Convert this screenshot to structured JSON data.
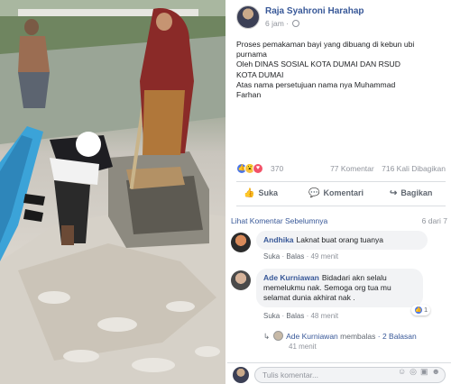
{
  "post": {
    "author": "Raja Syahroni Harahap",
    "time": "6 jam",
    "text": "Proses pemakaman bayi yang dibuang di kebun ubi\npurnama\nOleh DINAS SOSIAL KOTA DUMAI DAN RSUD\nKOTA DUMAI\nAtas nama persetujuan nama nya Muhammad\nFarhan",
    "reaction_count": "370",
    "comment_count": "77 Komentar",
    "share_count": "716 Kali Dibagikan"
  },
  "actions": {
    "like": "Suka",
    "comment": "Komentari",
    "share": "Bagikan"
  },
  "previous_comments": {
    "label": "Lihat Komentar Sebelumnya",
    "time": "6 dari 7"
  },
  "comments": [
    {
      "name": "Andhika",
      "text": "Laknat buat orang tuanya",
      "like": "Suka",
      "reply": "Balas",
      "time": "49 menit"
    },
    {
      "name": "Ade Kurniawan",
      "text": "Bidadari akn selalu memelukmu nak. Semoga org tua mu selamat dunia akhirat nak .",
      "like": "Suka",
      "reply": "Balas",
      "time": "48 menit",
      "likes": "1"
    }
  ],
  "reply": {
    "author": "Ade Kurniawan",
    "label": "membalas",
    "count": "2 Balasan",
    "time": "41 menit"
  },
  "composer": {
    "placeholder": "Tulis komentar..."
  },
  "icons": {
    "reactions": [
      "like-icon",
      "wow-icon",
      "love-icon"
    ],
    "composer": [
      "emoji-icon",
      "camera-icon",
      "gif-icon",
      "sticker-icon"
    ]
  },
  "colors": {
    "link": "#385898",
    "like": "#4a76e8",
    "love": "#f25268",
    "wow": "#f6c244"
  }
}
